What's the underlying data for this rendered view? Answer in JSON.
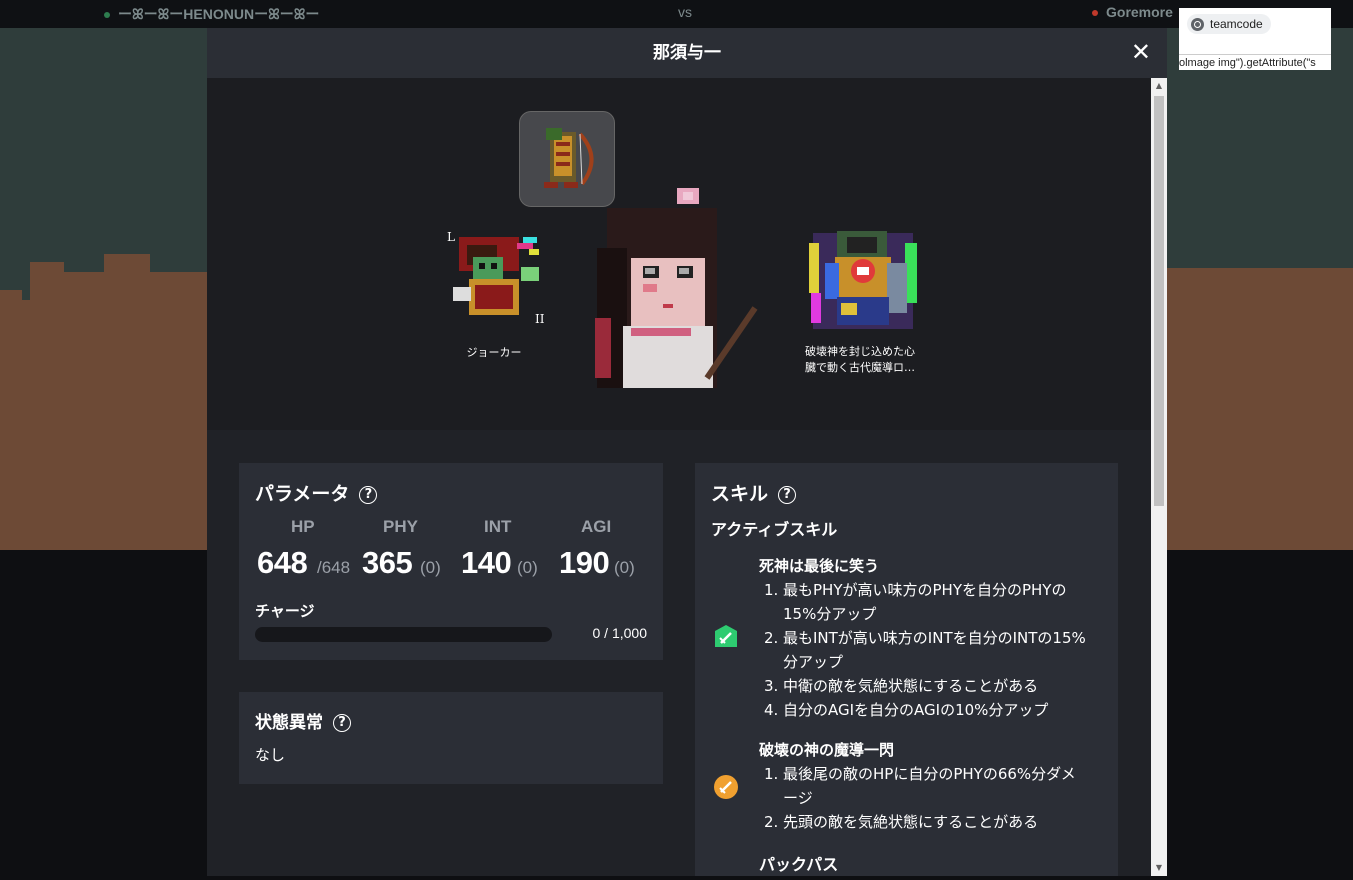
{
  "background": {
    "team_left": "ーꕤーꕤーHENONUNーꕤーꕤー",
    "vs": "vs",
    "team_right": "Goremore",
    "colors": {
      "scene": "#2f3d3b",
      "ground": "#6d4a36",
      "team_left_dot": "#2e7d4f",
      "team_right_dot": "#c0392b"
    }
  },
  "popup": {
    "site": "teamcode",
    "code_text": "olmage img\").getAttribute(\"s"
  },
  "modal": {
    "title": "那須与一",
    "close_label": "✕",
    "characters": {
      "left_name": "ジョーカー",
      "right_name": "破壊神を封じ込めた心臓で動く古代魔導ロ…"
    },
    "parameters": {
      "title": "パラメータ",
      "help": "?",
      "stats": [
        {
          "label": "HP",
          "value": "648",
          "sub": "/648"
        },
        {
          "label": "PHY",
          "value": "365",
          "sub": "(0)"
        },
        {
          "label": "INT",
          "value": "140",
          "sub": "(0)"
        },
        {
          "label": "AGI",
          "value": "190",
          "sub": "(0)"
        }
      ],
      "charge_label": "チャージ",
      "charge_value": "0 / 1,000",
      "charge_fraction": 0
    },
    "status": {
      "title": "状態異常",
      "help": "?",
      "value": "なし"
    },
    "skills": {
      "title": "スキル",
      "help": "?",
      "active_label": "アクティブスキル",
      "skill1": {
        "name": "死神は最後に笑う",
        "icon": "green-sword-shield-icon",
        "effects": [
          "最もPHYが高い味方のPHYを自分のPHYの",
          "15%分アップ",
          "最もINTが高い味方のINTを自分のINTの15%",
          "分アップ",
          "中衛の敵を気絶状態にすることがある",
          "自分のAGIを自分のAGIの10%分アップ"
        ]
      },
      "skill2": {
        "name": "破壊の神の魔導一閃",
        "icon": "orange-sword-circle-icon",
        "effects": [
          "最後尾の敵のHPに自分のPHYの66%分ダメ",
          "ージ",
          "先頭の敵を気絶状態にすることがある"
        ]
      },
      "passive_label": "パックパス"
    }
  }
}
